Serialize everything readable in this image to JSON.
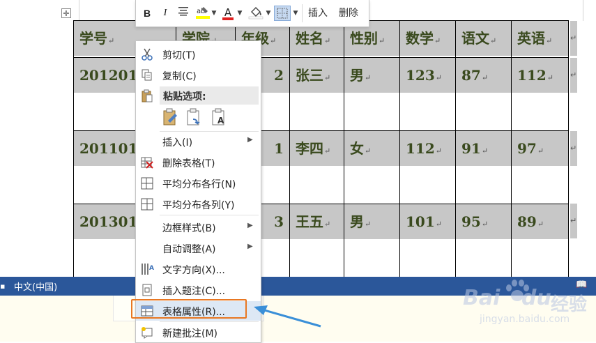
{
  "table": {
    "headers": [
      "学号",
      "学院",
      "年级",
      "姓名",
      "性别",
      "数学",
      "语文",
      "英语"
    ],
    "rows": [
      {
        "id": "2012010",
        "grade": "2",
        "name": "张三",
        "gender": "男",
        "math": "123",
        "chinese": "87",
        "english": "112"
      },
      {
        "id": "2011010",
        "grade": "1",
        "name": "李四",
        "gender": "女",
        "math": "112",
        "chinese": "91",
        "english": "97"
      },
      {
        "id": "2013010",
        "grade": "3",
        "name": "王五",
        "gender": "男",
        "math": "101",
        "chinese": "95",
        "english": "89"
      }
    ],
    "paragraph_mark": "↵",
    "move_handle_icon": "move-cross-icon"
  },
  "mini_toolbar": {
    "bold": "B",
    "italic": "I",
    "insert": "插入",
    "delete": "删除",
    "font_color": "A",
    "highlight_color": "#ffff00",
    "font_color_value": "#e02020"
  },
  "context_menu": {
    "cut": "剪切(T)",
    "copy": "复制(C)",
    "paste_options": "粘贴选项:",
    "insert": "插入(I)",
    "delete_table": "删除表格(T)",
    "distribute_rows": "平均分布各行(N)",
    "distribute_cols": "平均分布各列(Y)",
    "border_style": "边框样式(B)",
    "autofit": "自动调整(A)",
    "text_direction": "文字方向(X)...",
    "insert_caption": "插入题注(C)...",
    "table_properties": "表格属性(R)...",
    "new_comment": "新建批注(M)"
  },
  "status_bar": {
    "language": "中文(中国)"
  },
  "watermark": {
    "brand": "Bai",
    "brand_tail": "du",
    "jingyan": "经验",
    "url": "jingyan.baidu.com"
  },
  "colors": {
    "status_bar": "#2b579a",
    "highlight_box": "#e87722",
    "pointer_arrow": "#3a8fd8",
    "cell_shading": "#c7c7c7",
    "cell_text": "#3a4a1e"
  }
}
